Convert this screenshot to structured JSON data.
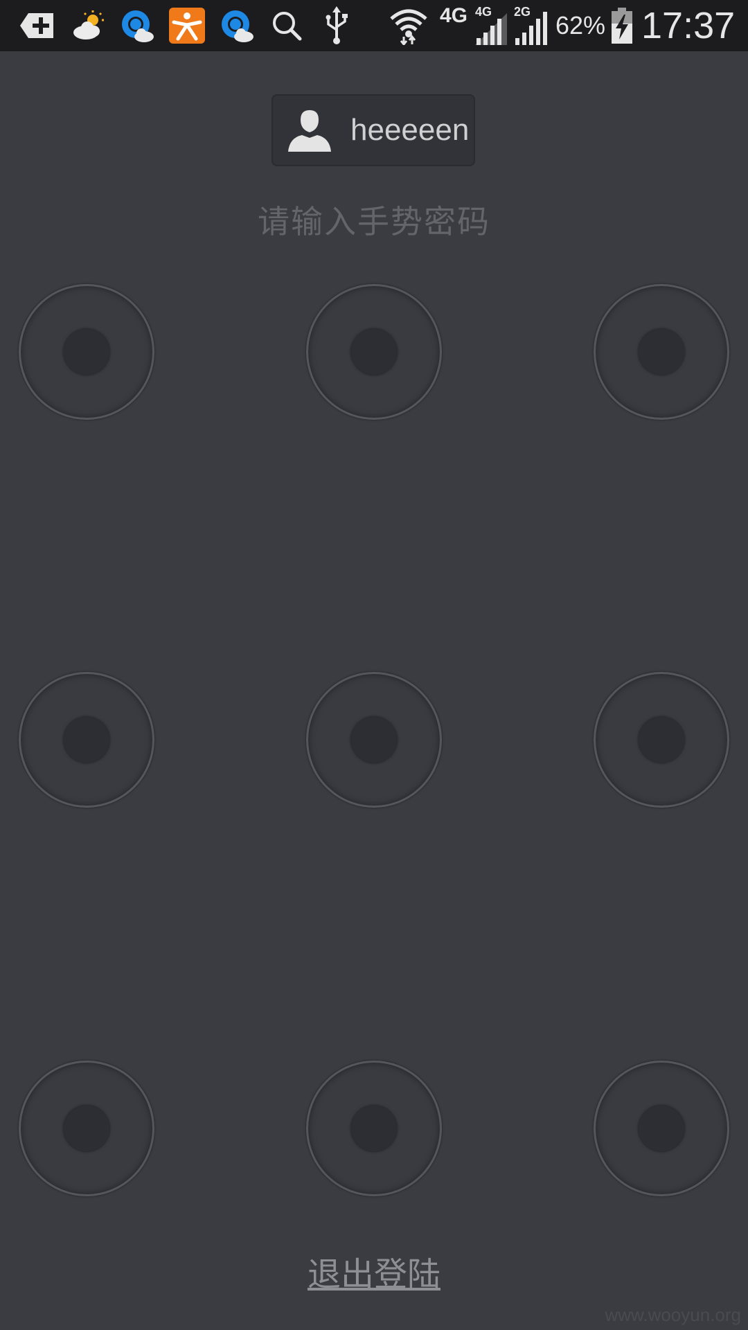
{
  "status_bar": {
    "network_primary": "4G",
    "network_sim1": "4G",
    "network_sim2": "2G",
    "battery": "62%",
    "time": "17:37",
    "icons": [
      "add-notification-icon",
      "weather-icon",
      "browser-icon",
      "app-icon",
      "browser-icon",
      "search-icon",
      "usb-icon",
      "wifi-icon",
      "signal-icon",
      "battery-charging-icon"
    ],
    "colors": {
      "background": "#1c1c1e",
      "browser_blue": "#1e88e5",
      "app_orange": "#f07a1a"
    }
  },
  "user": {
    "name": "heeeeen",
    "avatar_icon": "user-avatar-icon"
  },
  "prompt": "请输入手势密码",
  "gesture_pad": {
    "rows": 3,
    "columns": 3,
    "dots": [
      1,
      2,
      3,
      4,
      5,
      6,
      7,
      8,
      9
    ]
  },
  "logout_label": "退出登陆",
  "watermark": "www.wooyun.org",
  "colors": {
    "background": "#3b3c42",
    "dot_ring": "#55565b",
    "dot_core": "#2d2e33",
    "text_muted": "#64656a"
  }
}
